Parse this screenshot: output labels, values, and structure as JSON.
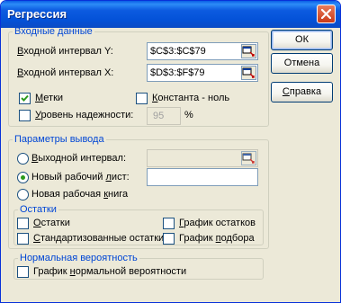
{
  "window": {
    "title": "Регрессия"
  },
  "input_group": {
    "legend": "Входные данные",
    "input_y": {
      "label_pre": "",
      "label_key": "В",
      "label_post": "ходной интервал Y:",
      "value": "$C$3:$C$79"
    },
    "input_x": {
      "label_pre": "",
      "label_key": "В",
      "label_post": "ходной интервал X:",
      "value": "$D$3:$F$79"
    },
    "labels_check": {
      "label_pre": "",
      "label_key": "М",
      "label_post": "етки",
      "checked": true
    },
    "constant_check": {
      "label_pre": "",
      "label_key": "К",
      "label_post": "онстанта - ноль",
      "checked": false
    },
    "confidence_check": {
      "label_pre": "",
      "label_key": "У",
      "label_post": "ровень надежности:",
      "checked": false,
      "value": "95",
      "unit": "%"
    }
  },
  "output_group": {
    "legend": "Параметры вывода",
    "output_range": {
      "label_pre": "",
      "label_key": "В",
      "label_post": "ыходной интервал:",
      "value": ""
    },
    "new_sheet": {
      "label_pre": "Новый рабочий ",
      "label_key": "л",
      "label_post": "ист:",
      "value": ""
    },
    "new_book": {
      "label_pre": "Новая рабочая ",
      "label_key": "к",
      "label_post": "нига"
    }
  },
  "residuals_group": {
    "legend": "Остатки",
    "residuals": {
      "label_pre": "",
      "label_key": "О",
      "label_post": "статки"
    },
    "std_residuals": {
      "label_pre": "",
      "label_key": "С",
      "label_post": "тандартизованные остатки"
    },
    "residual_plot": {
      "label_pre": "",
      "label_key": "Г",
      "label_post": "рафик остатков"
    },
    "fit_plot": {
      "label_pre": "График ",
      "label_key": "п",
      "label_post": "одбора"
    }
  },
  "normal_group": {
    "legend": "Нормальная вероятность",
    "normal_plot": {
      "label_pre": "График ",
      "label_key": "н",
      "label_post": "ормальной вероятности"
    }
  },
  "buttons": {
    "ok": "ОК",
    "cancel": "Отмена",
    "help_key": "С",
    "help_post": "правка"
  },
  "colors": {
    "accent": "#0046d5",
    "titlebar": "#0452d8",
    "radio_dot": "#2b9a1c",
    "check": "#2b9a1c"
  }
}
